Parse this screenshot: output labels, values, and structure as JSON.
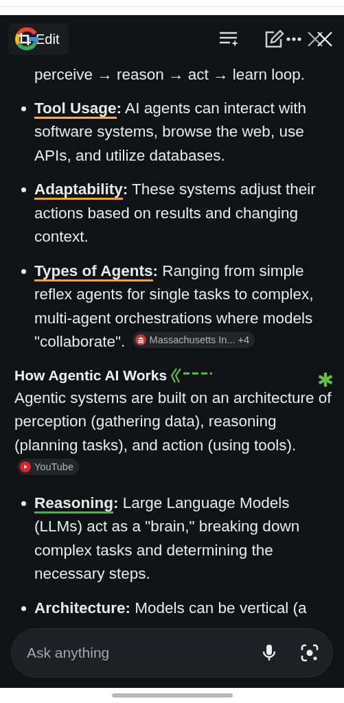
{
  "header": {
    "edit_label": "Edit"
  },
  "content": [
    {
      "kind": "continuation",
      "text": "perceive → reason → act → learn loop."
    },
    {
      "kind": "bullet",
      "term": "Tool Usage",
      "color": "#f2b33d",
      "text": "**:** AI agents can interact with software systems, browse the web, use APIs, and utilize databases."
    },
    {
      "kind": "bullet",
      "term": "Adaptability",
      "color": "#f5a524",
      "text": "**:** These systems adjust their actions based on results and changing context."
    },
    {
      "kind": "bullet",
      "term": "Types of Agents",
      "color": "#f0a53a",
      "text": "**:** Ranging from simple reflex agents for single tasks to complex, multi-agent orchestrations where models \"collaborate\".",
      "source": {
        "kind": "institution",
        "label": "Massachusetts In... +4"
      }
    },
    {
      "kind": "heading",
      "text": "How Agentic AI Works"
    },
    {
      "kind": "paragraph",
      "text": "Agentic systems are built on an architecture of perception (gathering data), reasoning (planning tasks), and action (using tools).",
      "source": {
        "kind": "video",
        "label": "YouTube"
      }
    },
    {
      "kind": "bullet",
      "term": "Reasoning",
      "color": "#3fb950",
      "text": "**:** Large Language Models (LLMs) act as a \"brain,\" breaking down complex tasks and determining the necessary steps."
    },
    {
      "kind": "bullet",
      "term": "Architecture",
      "text": "**:** Models can be vertical (a"
    }
  ],
  "ask_bar": {
    "placeholder": "Ask anything"
  }
}
